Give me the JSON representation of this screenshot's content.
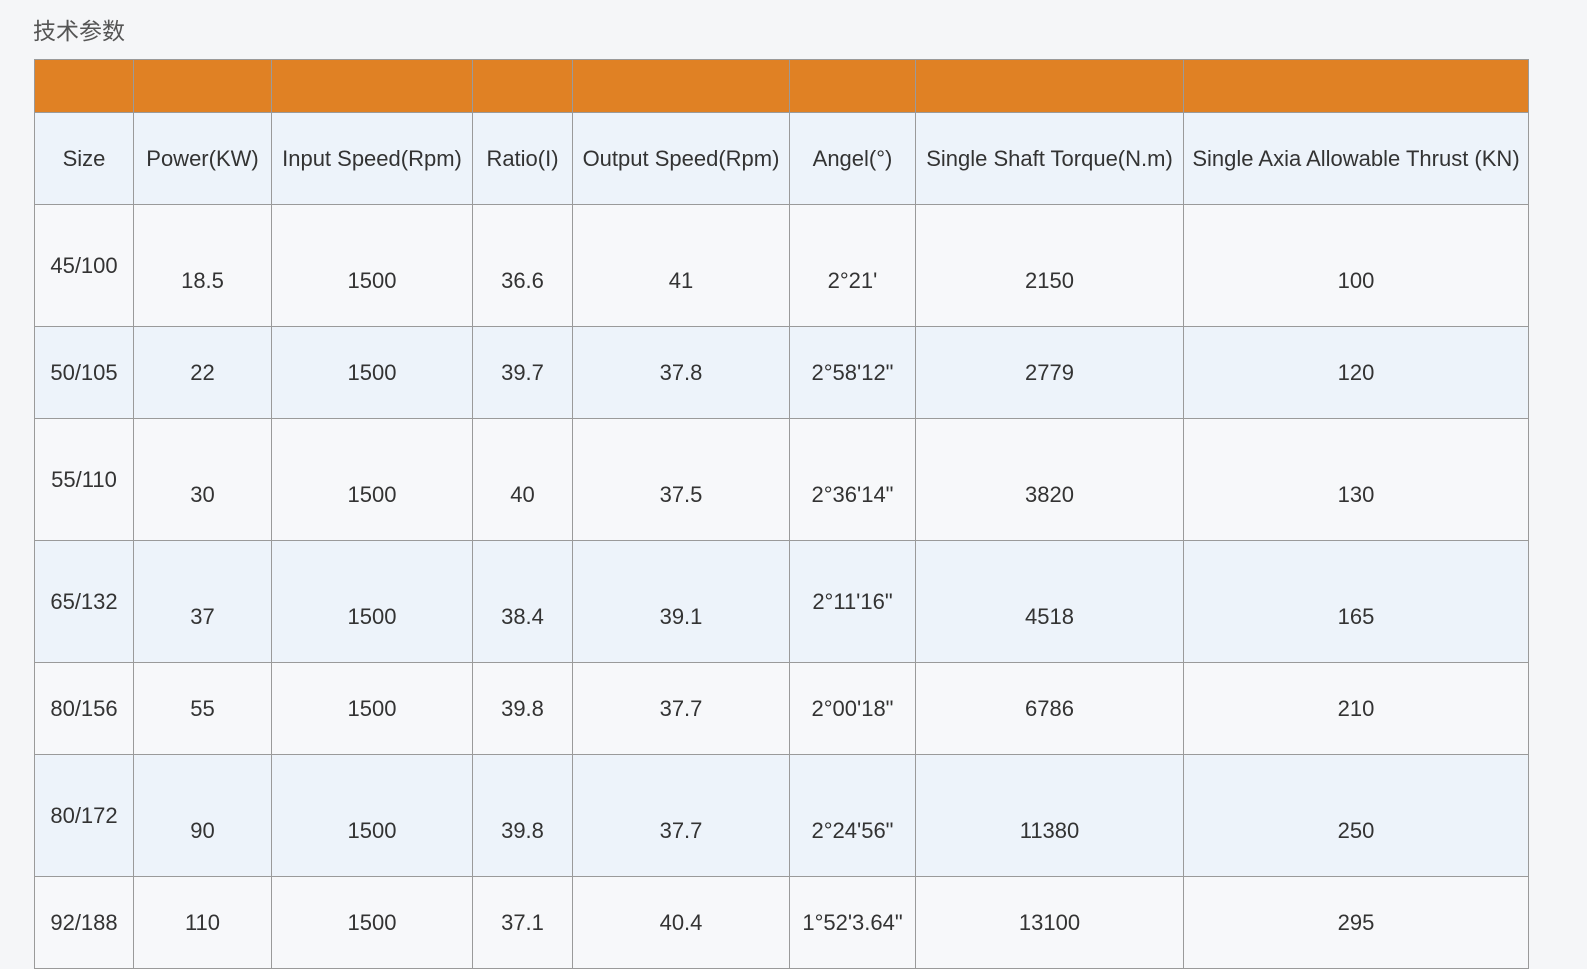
{
  "section_title": "技术参数",
  "table": {
    "accent_color": "#e08124",
    "headers": [
      "Size",
      "Power(KW)",
      "Input Speed(Rpm)",
      "Ratio(I)",
      "Output Speed(Rpm)",
      "Angel(°)",
      "Single Shaft Torque(N.m)",
      "Single Axia Allowable Thrust (KN)"
    ],
    "rows": [
      [
        "45/100",
        "18.5",
        "1500",
        "36.6",
        "41",
        "2°21'",
        "2150",
        "100"
      ],
      [
        "50/105",
        "22",
        "1500",
        "39.7",
        "37.8",
        "2°58'12\"",
        "2779",
        "120"
      ],
      [
        "55/110",
        "30",
        "1500",
        "40",
        "37.5",
        "2°36'14\"",
        "3820",
        "130"
      ],
      [
        "65/132",
        "37",
        "1500",
        "38.4",
        "39.1",
        "2°11'16\"",
        "4518",
        "165"
      ],
      [
        "80/156",
        "55",
        "1500",
        "39.8",
        "37.7",
        "2°00'18\"",
        "6786",
        "210"
      ],
      [
        "80/172",
        "90",
        "1500",
        "39.8",
        "37.7",
        "2°24'56\"",
        "11380",
        "250"
      ],
      [
        "92/188",
        "110",
        "1500",
        "37.1",
        "40.4",
        "1°52'3.64\"",
        "13100",
        "295"
      ]
    ]
  }
}
